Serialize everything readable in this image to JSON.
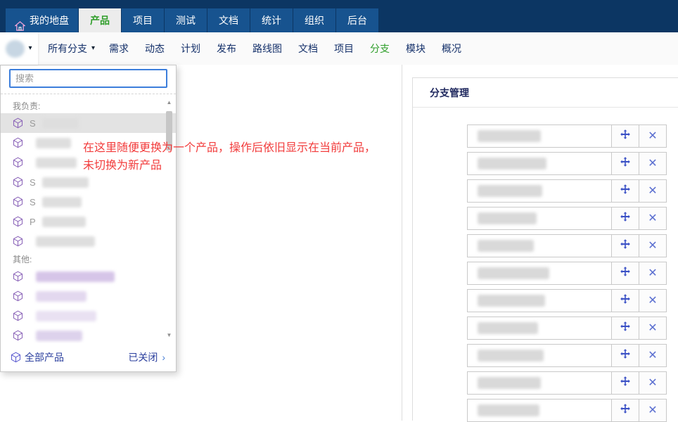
{
  "topnav": {
    "home_label": "我的地盘",
    "tabs": [
      {
        "label": "产品",
        "active": true
      },
      {
        "label": "项目"
      },
      {
        "label": "测试"
      },
      {
        "label": "文档"
      },
      {
        "label": "统计"
      },
      {
        "label": "组织"
      },
      {
        "label": "后台"
      }
    ]
  },
  "subnav": {
    "branch_filter_label": "所有分支",
    "items": [
      {
        "label": "需求"
      },
      {
        "label": "动态"
      },
      {
        "label": "计划"
      },
      {
        "label": "发布"
      },
      {
        "label": "路线图"
      },
      {
        "label": "文档"
      },
      {
        "label": "项目"
      },
      {
        "label": "分支",
        "active": true
      },
      {
        "label": "模块"
      },
      {
        "label": "概况"
      }
    ]
  },
  "dropdown": {
    "search_placeholder": "搜索",
    "my_label": "我负责:",
    "my_items": [
      {
        "text": "S",
        "blob_width": 52,
        "highlight": true
      },
      {
        "text": "",
        "blob_width": 50
      },
      {
        "text": "",
        "blob_width": 58
      },
      {
        "text": "S",
        "blob_width": 66
      },
      {
        "text": "S",
        "blob_width": 56
      },
      {
        "text": "P",
        "blob_width": 62
      },
      {
        "text": "",
        "blob_width": 84
      }
    ],
    "other_label": "其他:",
    "other_items": [
      {
        "text": "",
        "blob_width": 112,
        "tint": "#d6c5e8"
      },
      {
        "text": "",
        "blob_width": 72,
        "tint": "#e3d8ef"
      },
      {
        "text": "",
        "blob_width": 86,
        "tint": "#e9e1f2"
      },
      {
        "text": "",
        "blob_width": 66,
        "tint": "#ddd2ec"
      }
    ],
    "footer": {
      "all_products_label": "全部产品",
      "closed_label": "已关闭"
    }
  },
  "annotation": {
    "line1": "在这里随便更换为一个产品，操作后依旧显示在当前产品，",
    "line2": "未切换为新产品"
  },
  "branch_panel": {
    "title": "分支管理",
    "rows": [
      {
        "blob_width": 90
      },
      {
        "blob_width": 98
      },
      {
        "blob_width": 92
      },
      {
        "blob_width": 84
      },
      {
        "blob_width": 80
      },
      {
        "blob_width": 102
      },
      {
        "blob_width": 96
      },
      {
        "blob_width": 86
      },
      {
        "blob_width": 94
      },
      {
        "blob_width": 90
      },
      {
        "blob_width": 88
      }
    ]
  },
  "icons": {
    "caret": "▾",
    "scroll_up": "▲",
    "scroll_down": "▼",
    "chevron": "›",
    "close": "✕"
  },
  "colors": {
    "navbar_bg": "#0c3663",
    "tab_bg": "#17538f",
    "active_tab_green": "#2f9e2a",
    "annotation_red": "#f23c3c",
    "link_blue": "#2b3f9e",
    "icon_blue": "#3a50c5",
    "panel_title_navy": "#20295f"
  }
}
